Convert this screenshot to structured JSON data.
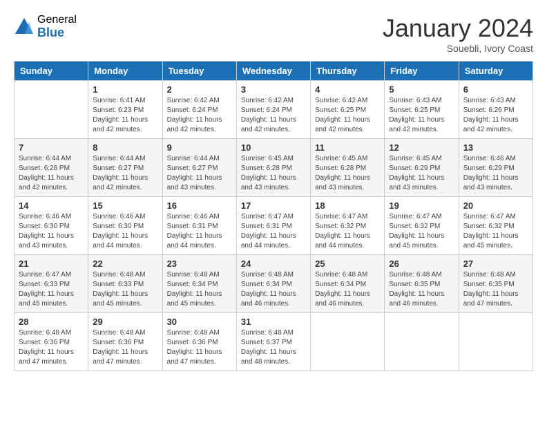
{
  "logo": {
    "general": "General",
    "blue": "Blue"
  },
  "title": "January 2024",
  "subtitle": "Souebli, Ivory Coast",
  "days": [
    "Sunday",
    "Monday",
    "Tuesday",
    "Wednesday",
    "Thursday",
    "Friday",
    "Saturday"
  ],
  "weeks": [
    [
      {
        "day": "",
        "info": ""
      },
      {
        "day": "1",
        "info": "Sunrise: 6:41 AM\nSunset: 6:23 PM\nDaylight: 11 hours\nand 42 minutes."
      },
      {
        "day": "2",
        "info": "Sunrise: 6:42 AM\nSunset: 6:24 PM\nDaylight: 11 hours\nand 42 minutes."
      },
      {
        "day": "3",
        "info": "Sunrise: 6:42 AM\nSunset: 6:24 PM\nDaylight: 11 hours\nand 42 minutes."
      },
      {
        "day": "4",
        "info": "Sunrise: 6:42 AM\nSunset: 6:25 PM\nDaylight: 11 hours\nand 42 minutes."
      },
      {
        "day": "5",
        "info": "Sunrise: 6:43 AM\nSunset: 6:25 PM\nDaylight: 11 hours\nand 42 minutes."
      },
      {
        "day": "6",
        "info": "Sunrise: 6:43 AM\nSunset: 6:26 PM\nDaylight: 11 hours\nand 42 minutes."
      }
    ],
    [
      {
        "day": "7",
        "info": "Sunrise: 6:44 AM\nSunset: 6:26 PM\nDaylight: 11 hours\nand 42 minutes."
      },
      {
        "day": "8",
        "info": "Sunrise: 6:44 AM\nSunset: 6:27 PM\nDaylight: 11 hours\nand 42 minutes."
      },
      {
        "day": "9",
        "info": "Sunrise: 6:44 AM\nSunset: 6:27 PM\nDaylight: 11 hours\nand 43 minutes."
      },
      {
        "day": "10",
        "info": "Sunrise: 6:45 AM\nSunset: 6:28 PM\nDaylight: 11 hours\nand 43 minutes."
      },
      {
        "day": "11",
        "info": "Sunrise: 6:45 AM\nSunset: 6:28 PM\nDaylight: 11 hours\nand 43 minutes."
      },
      {
        "day": "12",
        "info": "Sunrise: 6:45 AM\nSunset: 6:29 PM\nDaylight: 11 hours\nand 43 minutes."
      },
      {
        "day": "13",
        "info": "Sunrise: 6:46 AM\nSunset: 6:29 PM\nDaylight: 11 hours\nand 43 minutes."
      }
    ],
    [
      {
        "day": "14",
        "info": "Sunrise: 6:46 AM\nSunset: 6:30 PM\nDaylight: 11 hours\nand 43 minutes."
      },
      {
        "day": "15",
        "info": "Sunrise: 6:46 AM\nSunset: 6:30 PM\nDaylight: 11 hours\nand 44 minutes."
      },
      {
        "day": "16",
        "info": "Sunrise: 6:46 AM\nSunset: 6:31 PM\nDaylight: 11 hours\nand 44 minutes."
      },
      {
        "day": "17",
        "info": "Sunrise: 6:47 AM\nSunset: 6:31 PM\nDaylight: 11 hours\nand 44 minutes."
      },
      {
        "day": "18",
        "info": "Sunrise: 6:47 AM\nSunset: 6:32 PM\nDaylight: 11 hours\nand 44 minutes."
      },
      {
        "day": "19",
        "info": "Sunrise: 6:47 AM\nSunset: 6:32 PM\nDaylight: 11 hours\nand 45 minutes."
      },
      {
        "day": "20",
        "info": "Sunrise: 6:47 AM\nSunset: 6:32 PM\nDaylight: 11 hours\nand 45 minutes."
      }
    ],
    [
      {
        "day": "21",
        "info": "Sunrise: 6:47 AM\nSunset: 6:33 PM\nDaylight: 11 hours\nand 45 minutes."
      },
      {
        "day": "22",
        "info": "Sunrise: 6:48 AM\nSunset: 6:33 PM\nDaylight: 11 hours\nand 45 minutes."
      },
      {
        "day": "23",
        "info": "Sunrise: 6:48 AM\nSunset: 6:34 PM\nDaylight: 11 hours\nand 45 minutes."
      },
      {
        "day": "24",
        "info": "Sunrise: 6:48 AM\nSunset: 6:34 PM\nDaylight: 11 hours\nand 46 minutes."
      },
      {
        "day": "25",
        "info": "Sunrise: 6:48 AM\nSunset: 6:34 PM\nDaylight: 11 hours\nand 46 minutes."
      },
      {
        "day": "26",
        "info": "Sunrise: 6:48 AM\nSunset: 6:35 PM\nDaylight: 11 hours\nand 46 minutes."
      },
      {
        "day": "27",
        "info": "Sunrise: 6:48 AM\nSunset: 6:35 PM\nDaylight: 11 hours\nand 47 minutes."
      }
    ],
    [
      {
        "day": "28",
        "info": "Sunrise: 6:48 AM\nSunset: 6:36 PM\nDaylight: 11 hours\nand 47 minutes."
      },
      {
        "day": "29",
        "info": "Sunrise: 6:48 AM\nSunset: 6:36 PM\nDaylight: 11 hours\nand 47 minutes."
      },
      {
        "day": "30",
        "info": "Sunrise: 6:48 AM\nSunset: 6:36 PM\nDaylight: 11 hours\nand 47 minutes."
      },
      {
        "day": "31",
        "info": "Sunrise: 6:48 AM\nSunset: 6:37 PM\nDaylight: 11 hours\nand 48 minutes."
      },
      {
        "day": "",
        "info": ""
      },
      {
        "day": "",
        "info": ""
      },
      {
        "day": "",
        "info": ""
      }
    ]
  ]
}
